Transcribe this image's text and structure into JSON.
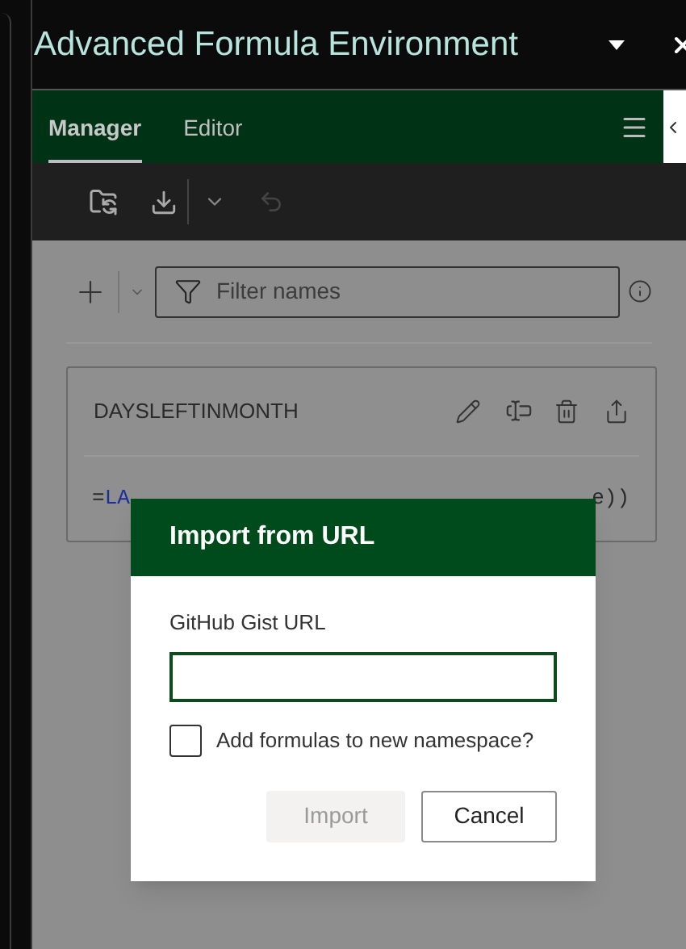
{
  "window": {
    "title": "Advanced Formula Environment"
  },
  "tabs": [
    {
      "label": "Manager",
      "selected": true
    },
    {
      "label": "Editor",
      "selected": false
    }
  ],
  "toolbar": {
    "undo_disabled": true
  },
  "filter": {
    "placeholder": "Filter names"
  },
  "card": {
    "name": "DAYSLEFTINMONTH",
    "formula": [
      {
        "kind": "plain",
        "text": "="
      },
      {
        "kind": "function",
        "text": "LA"
      }
    ],
    "formula_end": "e))"
  },
  "dialog": {
    "title": "Import from URL",
    "field_label": "GitHub Gist URL",
    "checkbox": {
      "label": "Add formulas to new namespace?",
      "checked": false
    },
    "buttons": [
      {
        "label": "Import",
        "disabled": true
      },
      {
        "label": "Cancel",
        "disabled": false
      }
    ]
  }
}
